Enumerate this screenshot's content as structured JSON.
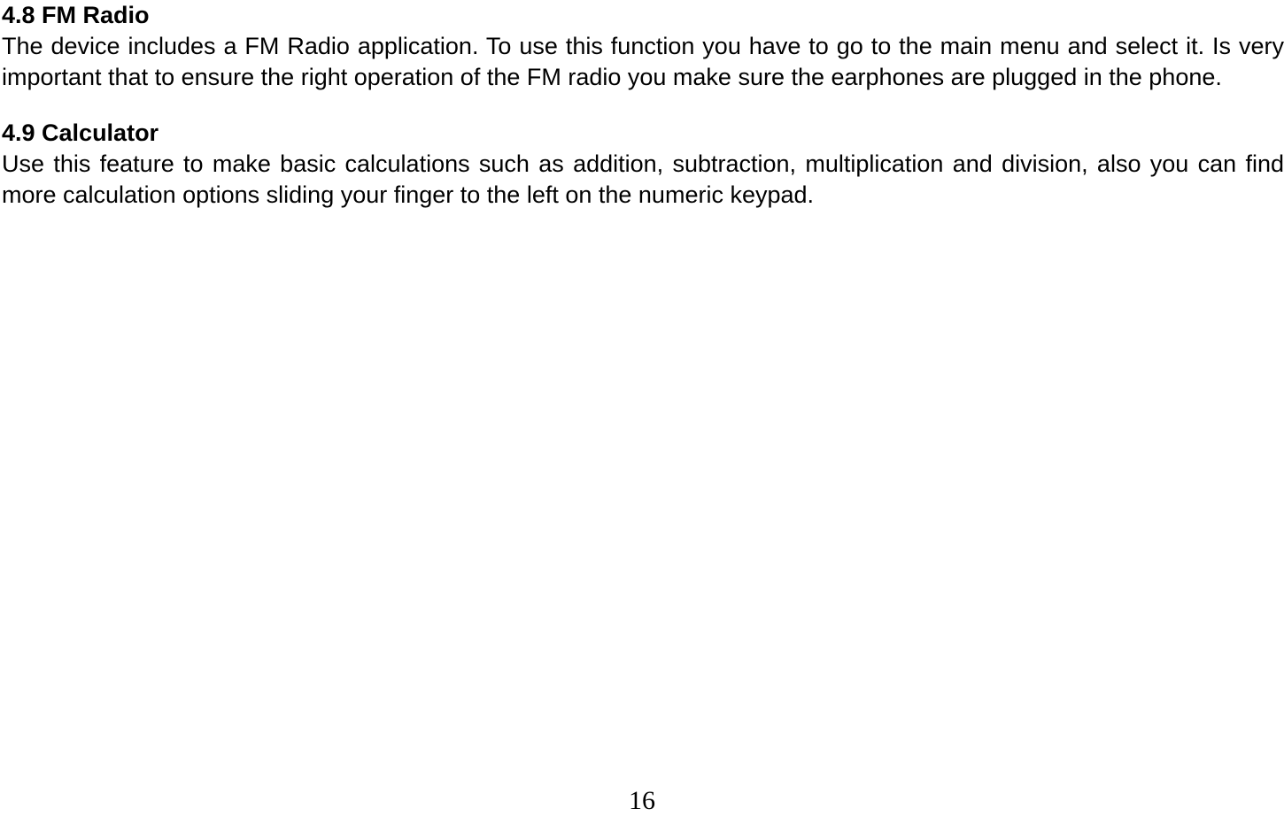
{
  "sections": [
    {
      "heading": "4.8 FM Radio",
      "body": "The device includes a FM Radio application. To use this function you have to go to the main menu and select it. Is very important that to ensure the right operation of the FM radio you make sure the earphones are plugged in the phone."
    },
    {
      "heading": "4.9 Calculator",
      "body": "Use this feature to make basic calculations such as addition, subtraction, multiplication and division, also you can find more calculation options sliding your finger to the left on the numeric keypad."
    }
  ],
  "page_number": "16"
}
